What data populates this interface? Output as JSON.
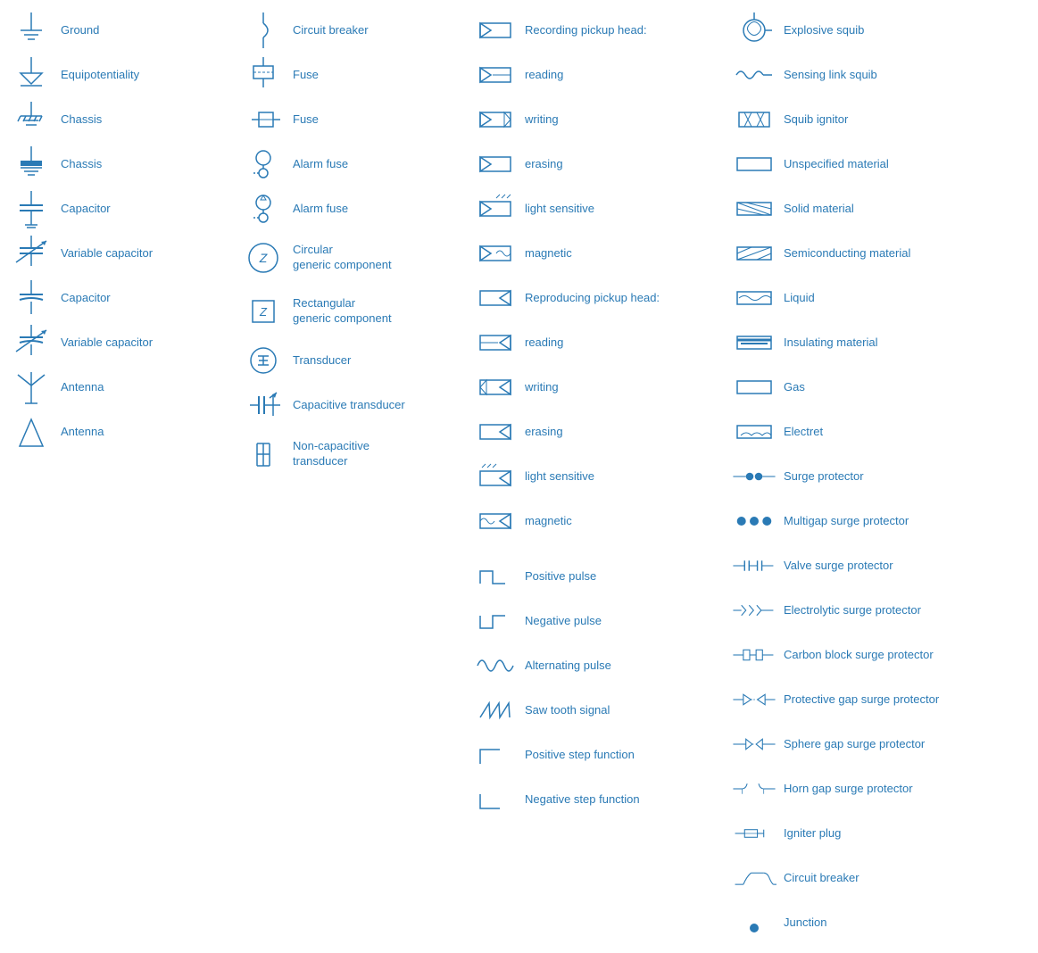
{
  "col1": [
    {
      "sym": "ground",
      "label": "Ground"
    },
    {
      "sym": "equipotentiality",
      "label": "Equipotentiality"
    },
    {
      "sym": "chassis1",
      "label": "Chassis"
    },
    {
      "sym": "chassis2",
      "label": "Chassis"
    },
    {
      "sym": "capacitor1",
      "label": "Capacitor"
    },
    {
      "sym": "variable_capacitor1",
      "label": "Variable capacitor"
    },
    {
      "sym": "capacitor2",
      "label": "Capacitor"
    },
    {
      "sym": "variable_capacitor2",
      "label": "Variable capacitor"
    },
    {
      "sym": "antenna1",
      "label": "Antenna"
    },
    {
      "sym": "antenna2",
      "label": "Antenna"
    }
  ],
  "col2": [
    {
      "sym": "circuit_breaker",
      "label": "Circuit breaker"
    },
    {
      "sym": "fuse1",
      "label": "Fuse"
    },
    {
      "sym": "fuse2",
      "label": "Fuse"
    },
    {
      "sym": "alarm_fuse1",
      "label": "Alarm fuse"
    },
    {
      "sym": "alarm_fuse2",
      "label": "Alarm fuse"
    },
    {
      "sym": "circular_generic",
      "label": "Circular\ngeneric component"
    },
    {
      "sym": "rectangular_generic",
      "label": "Rectangular\ngeneric component"
    },
    {
      "sym": "transducer",
      "label": "Transducer"
    },
    {
      "sym": "capacitive_transducer",
      "label": "Capacitive transducer"
    },
    {
      "sym": "non_capacitive_transducer",
      "label": "Non-capacitive\ntransducer"
    }
  ],
  "col3": [
    {
      "sym": "rph_label",
      "label": "Recording pickup head:"
    },
    {
      "sym": "rph_reading",
      "label": "reading"
    },
    {
      "sym": "rph_writing",
      "label": "writing"
    },
    {
      "sym": "rph_erasing",
      "label": "erasing"
    },
    {
      "sym": "rph_light",
      "label": "light sensitive"
    },
    {
      "sym": "rph_magnetic",
      "label": "magnetic"
    },
    {
      "sym": "repr_label",
      "label": "Reproducing pickup head:"
    },
    {
      "sym": "repr_reading",
      "label": "reading"
    },
    {
      "sym": "repr_writing",
      "label": "writing"
    },
    {
      "sym": "repr_erasing",
      "label": "erasing"
    },
    {
      "sym": "repr_light",
      "label": "light sensitive"
    },
    {
      "sym": "repr_magnetic",
      "label": "magnetic"
    },
    {
      "sym": "blank",
      "label": ""
    },
    {
      "sym": "positive_pulse",
      "label": "Positive pulse"
    },
    {
      "sym": "negative_pulse",
      "label": "Negative pulse"
    },
    {
      "sym": "alternating_pulse",
      "label": "Alternating pulse"
    },
    {
      "sym": "saw_tooth",
      "label": "Saw tooth signal"
    },
    {
      "sym": "positive_step",
      "label": "Positive step function"
    },
    {
      "sym": "negative_step",
      "label": "Negative step function"
    }
  ],
  "col4": [
    {
      "sym": "explosive_squib",
      "label": "Explosive squib"
    },
    {
      "sym": "sensing_squib",
      "label": "Sensing link squib"
    },
    {
      "sym": "squib_ignitor",
      "label": "Squib ignitor"
    },
    {
      "sym": "unspecified_material",
      "label": "Unspecified material"
    },
    {
      "sym": "solid_material",
      "label": "Solid material"
    },
    {
      "sym": "semiconducting",
      "label": "Semiconducting material"
    },
    {
      "sym": "liquid",
      "label": "Liquid"
    },
    {
      "sym": "insulating",
      "label": "Insulating material"
    },
    {
      "sym": "gas",
      "label": "Gas"
    },
    {
      "sym": "electret",
      "label": "Electret"
    },
    {
      "sym": "surge_protector",
      "label": "Surge protector"
    },
    {
      "sym": "multigap",
      "label": "Multigap surge protector"
    },
    {
      "sym": "valve_surge",
      "label": "Valve surge protector"
    },
    {
      "sym": "electrolytic_surge",
      "label": "Electrolytic surge protector"
    },
    {
      "sym": "carbon_block",
      "label": "Carbon block surge protector"
    },
    {
      "sym": "protective_gap",
      "label": "Protective gap surge protector"
    },
    {
      "sym": "sphere_gap",
      "label": "Sphere gap surge protector"
    },
    {
      "sym": "horn_gap",
      "label": "Horn gap surge protector"
    },
    {
      "sym": "igniter_plug",
      "label": "Igniter plug"
    },
    {
      "sym": "circuit_breaker2",
      "label": "Circuit breaker"
    },
    {
      "sym": "junction",
      "label": "Junction"
    }
  ]
}
